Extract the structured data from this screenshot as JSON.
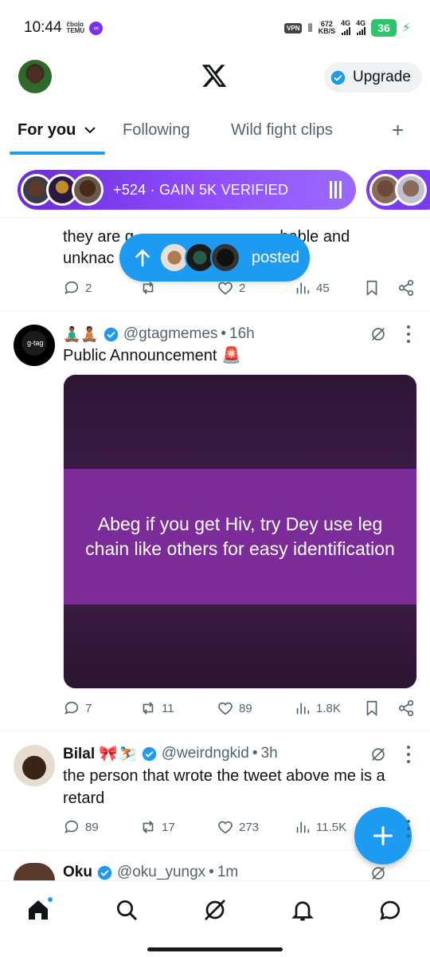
{
  "status_bar": {
    "time": "10:44",
    "temu_line1": "ĉboĵɑ",
    "temu_line2": "TEMU",
    "vpn": "VPN",
    "speed_value": "672",
    "speed_unit": "KB/S",
    "net1": "4G",
    "net2": "4G",
    "battery": "36"
  },
  "header": {
    "upgrade_label": "Upgrade"
  },
  "tabs": [
    {
      "label": "For you"
    },
    {
      "label": "Following"
    },
    {
      "label": "Wild fight clips"
    }
  ],
  "tab_add": "+",
  "promo": {
    "label": "+524 · GAIN 5K VERIFIED"
  },
  "new_posts_pill": {
    "label": "posted"
  },
  "partial_tweet": {
    "text": "they are g... ...hable and unknac...",
    "line1": "they are g",
    "line1_end": "hable and",
    "line2": "unknac",
    "replies": "2",
    "likes": "2",
    "views": "45"
  },
  "tweet1": {
    "emojis": "🧘🏾‍♂️🧘🏾",
    "handle": "@gtagmemes",
    "time": "16h",
    "text": "Public Announcement 🚨",
    "media_text": "Abeg if you get Hiv, try Dey use leg chain like others for easy identification",
    "replies": "7",
    "reposts": "11",
    "likes": "89",
    "views": "1.8K"
  },
  "tweet2": {
    "name": "Bilal 🎀⛷️",
    "handle": "@weirdngkid",
    "time": "3h",
    "text": "the person that wrote the tweet above me is a retard",
    "replies": "89",
    "reposts": "17",
    "likes": "273",
    "views": "11.5K"
  },
  "tweet3": {
    "name": "Oku",
    "handle": "@oku_yungx",
    "time": "1m"
  },
  "colors": {
    "accent": "#1d9bf0",
    "promo": "#8f4dff",
    "media_band": "#7b2c99"
  },
  "icons": [
    "x-logo-icon",
    "verified-icon",
    "chevron-down-icon",
    "reply-icon",
    "repost-icon",
    "like-icon",
    "views-icon",
    "bookmark-icon",
    "share-icon",
    "grok-icon",
    "more-icon",
    "home-icon",
    "search-icon",
    "grok-nav-icon",
    "bell-icon",
    "messages-icon",
    "compose-plus-icon",
    "arrow-up-icon"
  ]
}
